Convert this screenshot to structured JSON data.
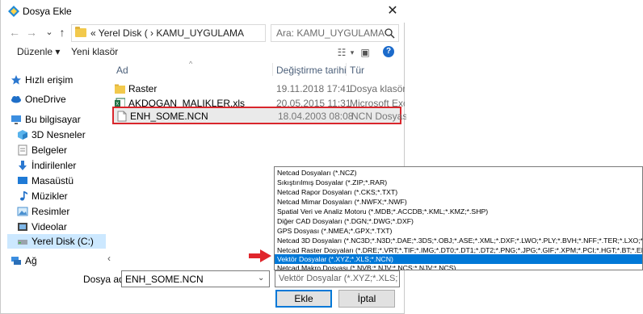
{
  "window": {
    "title": "Dosya Ekle",
    "close_label": "✕"
  },
  "navigation": {
    "back_glyph": "←",
    "forward_glyph": "→",
    "recent_glyph": "⌄",
    "up_glyph": "↑",
    "address_path": "« Yerel Disk ( › KAMU_UYGULAMA",
    "search_placeholder": "Ara: KAMU_UYGULAMA"
  },
  "toolbar": {
    "organize_label": "Düzenle ▾",
    "new_folder_label": "Yeni klasör",
    "help_label": "?"
  },
  "sidebar": {
    "items": [
      {
        "label": "Hızlı erişim",
        "icon": "star-icon"
      },
      {
        "label": "OneDrive",
        "icon": "cloud-icon"
      },
      {
        "label": "Bu bilgisayar",
        "icon": "computer-icon"
      },
      {
        "label": "3D Nesneler",
        "icon": "cube-icon"
      },
      {
        "label": "Belgeler",
        "icon": "document-icon"
      },
      {
        "label": "İndirilenler",
        "icon": "download-icon"
      },
      {
        "label": "Masaüstü",
        "icon": "desktop-icon"
      },
      {
        "label": "Müzikler",
        "icon": "music-icon"
      },
      {
        "label": "Resimler",
        "icon": "picture-icon"
      },
      {
        "label": "Videolar",
        "icon": "video-icon"
      },
      {
        "label": "Yerel Disk (C:)",
        "icon": "drive-icon"
      },
      {
        "label": "Ağ",
        "icon": "network-icon"
      }
    ]
  },
  "file_list": {
    "columns": {
      "name": "Ad",
      "date": "Değiştirme tarihi",
      "type": "Tür"
    },
    "rows": [
      {
        "name": "Raster",
        "date": "19.11.2018 17:41",
        "type": "Dosya klasörü",
        "icon": "folder-icon"
      },
      {
        "name": "AKDOGAN_MALIKLER.xls",
        "date": "20.05.2015 11:31",
        "type": "Microsoft Excel",
        "icon": "excel-icon"
      },
      {
        "name": "ENH_SOME.NCN",
        "date": "18.04.2003 08:08",
        "type": "NCN Dosyası",
        "icon": "file-icon"
      }
    ]
  },
  "footer": {
    "filename_label": "Dosya adı:",
    "filename_value": "ENH_SOME.NCN",
    "filetype_value": "Vektör Dosyalar (*.XYZ;*.XLS;*.NCN)",
    "open_label": "Ekle",
    "cancel_label": "İptal"
  },
  "filetype_options": [
    "Netcad Dosyaları (*.NCZ)",
    "Sıkıştırılmış Dosyalar (*.ZIP;*.RAR)",
    "Netcad Rapor Dosyaları (*.CKS;*.TXT)",
    "Netcad Mimar Dosyaları (*.NWFX;*.NWF)",
    "Spatial Veri ve Analiz Motoru (*.MDB;*.ACCDB;*.KML;*.KMZ;*.SHP)",
    "Diğer CAD Dosyaları (*.DGN;*.DWG;*.DXF)",
    "GPS Dosyası (*.NMEA;*.GPX;*.TXT)",
    "Netcad 3D Dosyaları (*.NC3D;*.N3D;*.DAE;*.3DS;*.OBJ;*.ASE;*.XML;*.DXF;*.LWO;*.PLY;*.BVH;*.NFF;*.TER;*.LXO;*.S",
    "Netcad Raster Dosyaları (*.DRE;*.VRT;*.TIF;*.IMG;*.DT0;*.DT1;*.DT2;*.PNG;*.JPG;*.GIF;*.XPM;*.PCI;*.HGT;*.BT;*.ER",
    "Vektör Dosyalar (*.XYZ;*.XLS;*.NCN)",
    "Netcad Makro Dosyası (*.NVB;*.NJV;*.NCS;*.NJV;*.NCS)"
  ],
  "selected_option_index": 9,
  "colors": {
    "selection": "#0078d7",
    "highlight_box": "#d9262c",
    "annotation_arrow": "#e0262c"
  }
}
